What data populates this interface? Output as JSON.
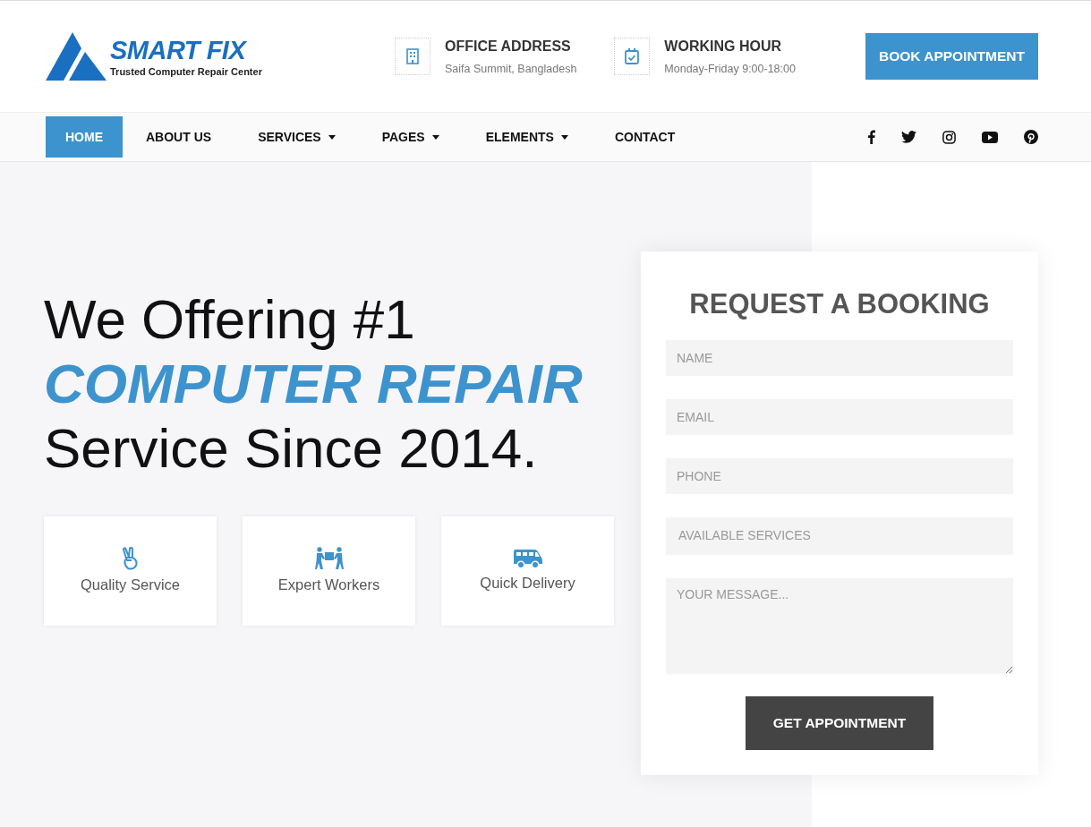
{
  "logo": {
    "title": "SMART FIX",
    "tagline": "Trusted Computer Repair Center"
  },
  "contacts": [
    {
      "kind": "address",
      "title": "OFFICE ADDRESS",
      "text": "Saifa Summit, Bangladesh"
    },
    {
      "kind": "hours",
      "title": "WORKING HOUR",
      "text": "Monday-Friday 9:00-18:00"
    }
  ],
  "book_button": "BOOK APPOINTMENT",
  "nav": [
    {
      "label": "HOME",
      "selected": true,
      "dropdown": false
    },
    {
      "label": "ABOUT US",
      "selected": false,
      "dropdown": false
    },
    {
      "label": "SERVICES",
      "selected": false,
      "dropdown": true
    },
    {
      "label": "PAGES",
      "selected": false,
      "dropdown": true
    },
    {
      "label": "ELEMENTS",
      "selected": false,
      "dropdown": true
    },
    {
      "label": "CONTACT",
      "selected": false,
      "dropdown": false
    }
  ],
  "hero": {
    "line_1": "We Offering #1",
    "highlight": "COMPUTER REPAIR",
    "line_3": "Service Since 2014."
  },
  "features": [
    {
      "kind": "peace",
      "label": "Quality Service"
    },
    {
      "kind": "workers",
      "label": "Expert Workers"
    },
    {
      "kind": "van",
      "label": "Quick Delivery"
    }
  ],
  "booking": {
    "title": "REQUEST A BOOKING",
    "fields": [
      {
        "kind": "text",
        "placeholder": "NAME"
      },
      {
        "kind": "text",
        "placeholder": "EMAIL"
      },
      {
        "kind": "text",
        "placeholder": "PHONE"
      },
      {
        "kind": "select",
        "placeholder": "AVAILABLE SERVICES"
      },
      {
        "kind": "textarea",
        "placeholder": "YOUR MESSAGE..."
      }
    ],
    "submit": "GET APPOINTMENT"
  }
}
